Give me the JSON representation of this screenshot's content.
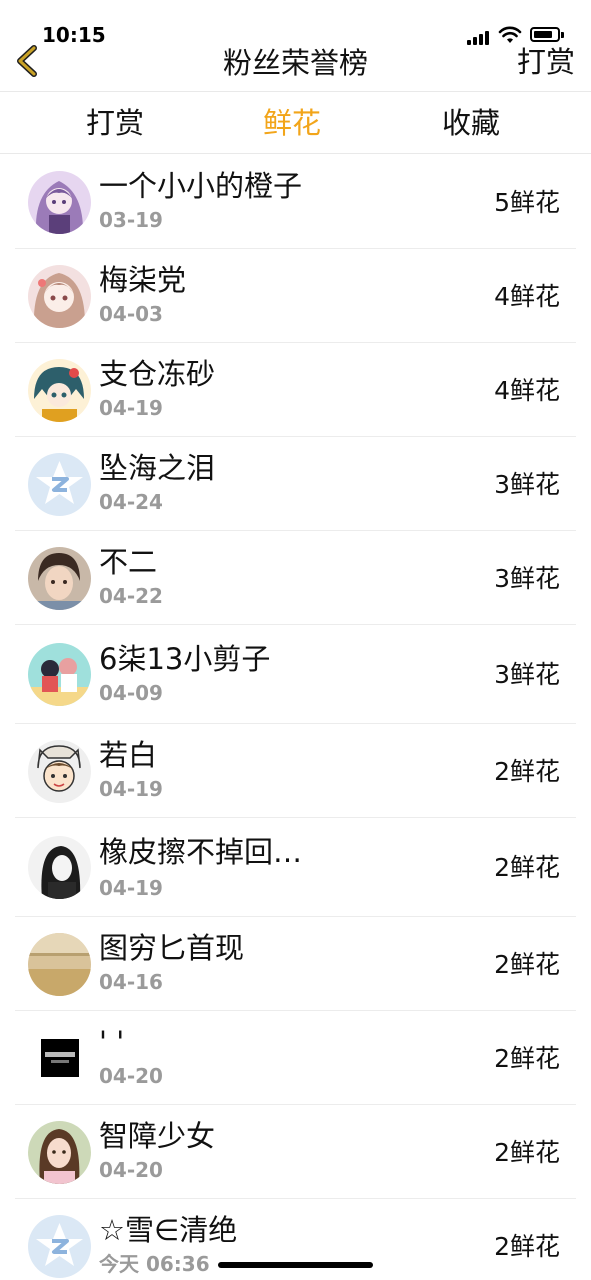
{
  "status_bar": {
    "time": "10:15"
  },
  "header": {
    "title": "粉丝荣誉榜",
    "action_label": "打赏",
    "back_icon": "chevron-left-icon"
  },
  "tabs": [
    {
      "label": "打赏",
      "active": false
    },
    {
      "label": "鲜花",
      "active": true
    },
    {
      "label": "收藏",
      "active": false
    }
  ],
  "colors": {
    "accent": "#f2a51a",
    "back_icon": "#c9a227",
    "date_text": "#9a9a9a",
    "default_avatar": "#dbe8f5"
  },
  "fans": [
    {
      "name": "一个小小的橙子",
      "date": "03-19",
      "count": "5鲜花",
      "avatar": "anime-girl-purple"
    },
    {
      "name": "梅柒党",
      "date": "04-03",
      "count": "4鲜花",
      "avatar": "anime-girl-pink"
    },
    {
      "name": "支仓冻砂",
      "date": "04-19",
      "count": "4鲜花",
      "avatar": "anime-girl-teal"
    },
    {
      "name": "坠海之泪",
      "date": "04-24",
      "count": "3鲜花",
      "avatar": "default-star-avatar"
    },
    {
      "name": "不二",
      "date": "04-22",
      "count": "3鲜花",
      "avatar": "photo-boy"
    },
    {
      "name": "6柒13小剪子",
      "date": "04-09",
      "count": "3鲜花",
      "avatar": "illustration-couple"
    },
    {
      "name": "若白",
      "date": "04-19",
      "count": "2鲜花",
      "avatar": "cartoon-boy-cat-hat"
    },
    {
      "name": "橡皮擦不掉回…",
      "date": "04-19",
      "count": "2鲜花",
      "avatar": "sketch-girl"
    },
    {
      "name": "图穷匕首现",
      "date": "04-16",
      "count": "2鲜花",
      "avatar": "wheat-field"
    },
    {
      "name": "' '",
      "date": "04-20",
      "count": "2鲜花",
      "avatar": "black-square-text"
    },
    {
      "name": "智障少女",
      "date": "04-20",
      "count": "2鲜花",
      "avatar": "photo-girl"
    },
    {
      "name": "☆雪∈清绝",
      "date": "今天 06:36",
      "count": "2鲜花",
      "avatar": "default-star-avatar"
    }
  ]
}
